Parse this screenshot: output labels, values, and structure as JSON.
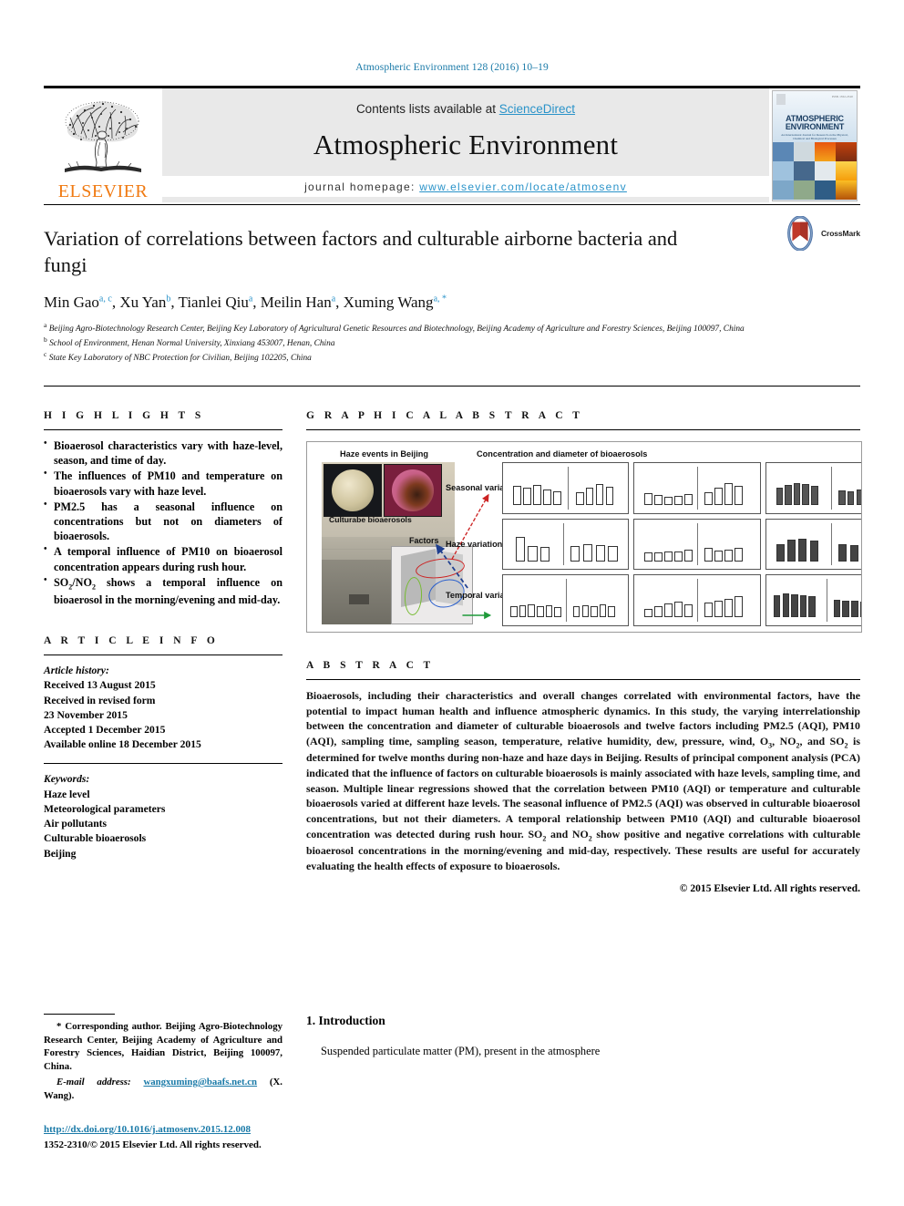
{
  "running_head": "Atmospheric Environment 128 (2016) 10–19",
  "banner": {
    "contents_prefix": "Contents lists available at ",
    "sciencedirect": "ScienceDirect",
    "journal_title": "Atmospheric Environment",
    "homepage_label": "journal homepage: ",
    "homepage_url": "www.elsevier.com/locate/atmosenv",
    "publisher_wordmark": "ELSEVIER",
    "cover": {
      "title_line1": "ATMOSPHERIC",
      "title_line2": "ENVIRONMENT",
      "subtitle": "An International Journal for Research on the Physical, Chemical and Biological Processes",
      "corner_code": "ISSN 1352-2310"
    }
  },
  "article": {
    "title": "Variation of correlations between factors and culturable airborne bacteria and fungi",
    "authors": [
      {
        "name": "Min Gao",
        "marks": "a, c"
      },
      {
        "name": "Xu Yan",
        "marks": "b"
      },
      {
        "name": "Tianlei Qiu",
        "marks": "a"
      },
      {
        "name": "Meilin Han",
        "marks": "a"
      },
      {
        "name": "Xuming Wang",
        "marks": "a, *"
      }
    ],
    "affiliations": [
      {
        "mark": "a",
        "text": "Beijing Agro-Biotechnology Research Center, Beijing Key Laboratory of Agricultural Genetic Resources and Biotechnology, Beijing Academy of Agriculture and Forestry Sciences, Beijing 100097, China"
      },
      {
        "mark": "b",
        "text": "School of Environment, Henan Normal University, Xinxiang 453007, Henan, China"
      },
      {
        "mark": "c",
        "text": "State Key Laboratory of NBC Protection for Civilian, Beijing 102205, China"
      }
    ],
    "crossmark_label": "CrossMark"
  },
  "highlights": {
    "heading": "H I G H L I G H T S",
    "items": [
      "Bioaerosol characteristics vary with haze-level, season, and time of day.",
      "The influences of PM10 and temperature on bioaerosols vary with haze level.",
      "PM2.5 has a seasonal influence on concentrations but not on diameters of bioaerosols.",
      "A temporal influence of PM10 on bioaerosol concentration appears during rush hour.",
      "SO2/NO2 shows a temporal influence on bioaerosol in the morning/evening and mid-day."
    ]
  },
  "article_info": {
    "heading": "A R T I C L E   I N F O",
    "history_label": "Article history:",
    "history": [
      "Received 13 August 2015",
      "Received in revised form",
      "23 November 2015",
      "Accepted 1 December 2015",
      "Available online 18 December 2015"
    ],
    "keywords_label": "Keywords:",
    "keywords": [
      "Haze level",
      "Meteorological parameters",
      "Air pollutants",
      "Culturable bioaerosols",
      "Beijing"
    ]
  },
  "graphical_abstract": {
    "heading": "G R A P H I C A L   A B S T R A C T",
    "labels": {
      "haze_events": "Haze events in Beijing",
      "concentration": "Concentration and diameter of bioaerosols",
      "culturable": "Culturabe bioaerosols",
      "factors": "Factors",
      "seasonal": "Seasonal variation",
      "haze": "Haze variation",
      "temporal": "Temporal variation"
    },
    "arrow_colors": {
      "seasonal": "#cc2222",
      "haze": "#1f3f8f",
      "temporal": "#1f9a3a"
    }
  },
  "abstract": {
    "heading": "A B S T R A C T",
    "text": "Bioaerosols, including their characteristics and overall changes correlated with environmental factors, have the potential to impact human health and influence atmospheric dynamics. In this study, the varying interrelationship between the concentration and diameter of culturable bioaerosols and twelve factors including PM2.5 (AQI), PM10 (AQI), sampling time, sampling season, temperature, relative humidity, dew, pressure, wind, O3, NO2, and SO2 is determined for twelve months during non-haze and haze days in Beijing. Results of principal component analysis (PCA) indicated that the influence of factors on culturable bioaerosols is mainly associated with haze levels, sampling time, and season. Multiple linear regressions showed that the correlation between PM10 (AQI) or temperature and culturable bioaerosols varied at different haze levels. The seasonal influence of PM2.5 (AQI) was observed in culturable bioaerosol concentrations, but not their diameters. A temporal relationship between PM10 (AQI) and culturable bioaerosol concentration was detected during rush hour. SO2 and NO2 show positive and negative correlations with culturable bioaerosol concentrations in the morning/evening and mid-day, respectively. These results are useful for accurately evaluating the health effects of exposure to bioaerosols.",
    "copyright": "© 2015 Elsevier Ltd. All rights reserved."
  },
  "footnote": {
    "corresponding": "* Corresponding author. Beijing Agro-Biotechnology Research Center, Beijing Academy of Agriculture and Forestry Sciences, Haidian District, Beijing 100097, China.",
    "email_label": "E-mail address: ",
    "email": "wangxuming@baafs.net.cn",
    "email_suffix": " (X. Wang).",
    "doi": "http://dx.doi.org/10.1016/j.atmosenv.2015.12.008",
    "issn_line": "1352-2310/© 2015 Elsevier Ltd. All rights reserved."
  },
  "introduction": {
    "heading": "1. Introduction",
    "first_line": "Suspended particulate matter (PM), present in the atmosphere"
  },
  "colors": {
    "link_blue": "#1a7aa8",
    "sciencedirect_blue": "#2a93c9",
    "elsevier_orange": "#f07a12"
  }
}
